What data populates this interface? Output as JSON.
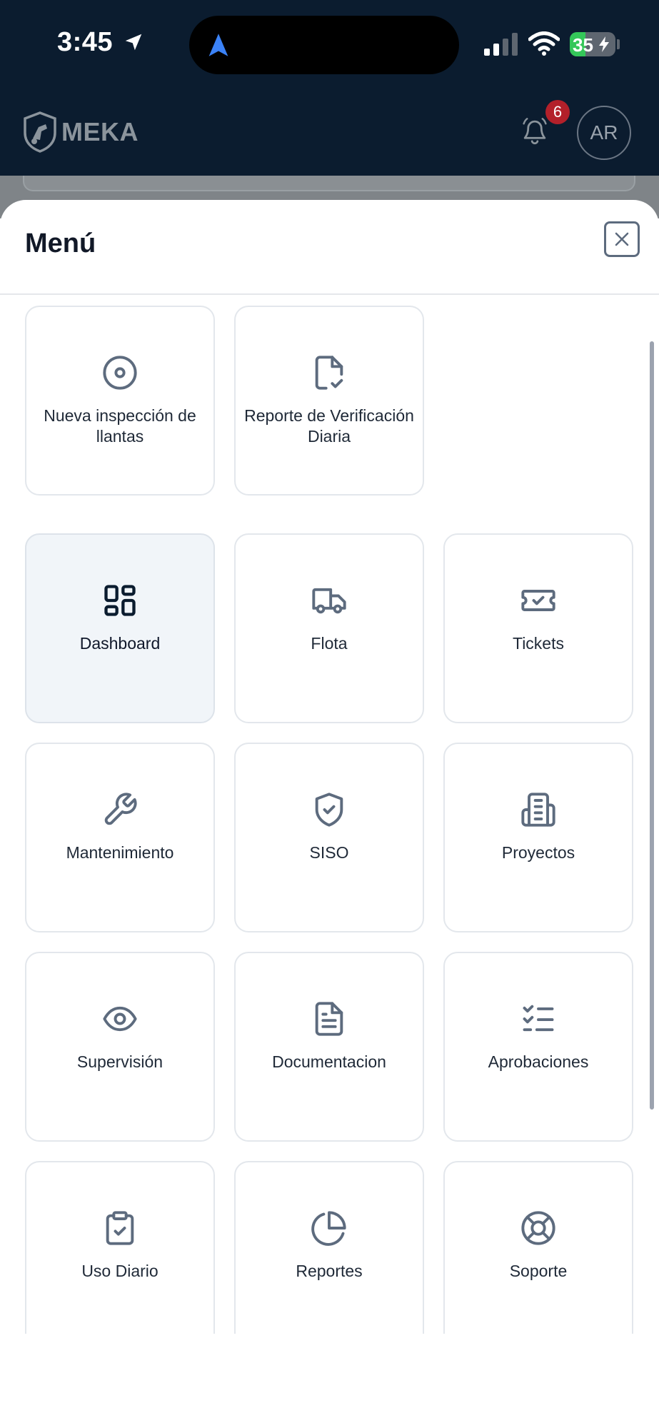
{
  "status_bar": {
    "time": "3:45",
    "battery": "35",
    "battery_level": 0.35
  },
  "header": {
    "logo_text": "MEKA",
    "notification_count": "6",
    "avatar_initials": "AR"
  },
  "menu": {
    "title": "Menú",
    "close_icon": "close-icon",
    "items": [
      {
        "label": "Nueva inspección de llantas",
        "icon": "disc-icon"
      },
      {
        "label": "Reporte de Verificación Diaria",
        "icon": "file-check-icon"
      },
      {
        "label": "Dashboard",
        "icon": "dashboard-icon",
        "active": true
      },
      {
        "label": "Flota",
        "icon": "truck-icon"
      },
      {
        "label": "Tickets",
        "icon": "ticket-icon"
      },
      {
        "label": "Mantenimiento",
        "icon": "wrench-icon"
      },
      {
        "label": "SISO",
        "icon": "shield-check-icon"
      },
      {
        "label": "Proyectos",
        "icon": "building-icon"
      },
      {
        "label": "Supervisión",
        "icon": "eye-icon"
      },
      {
        "label": "Documentacion",
        "icon": "document-icon"
      },
      {
        "label": "Aprobaciones",
        "icon": "checklist-icon"
      },
      {
        "label": "Uso Diario",
        "icon": "clipboard-check-icon"
      },
      {
        "label": "Reportes",
        "icon": "pie-chart-icon"
      },
      {
        "label": "Soporte",
        "icon": "lifebuoy-icon"
      }
    ]
  },
  "colors": {
    "header_bg": "#0b1c2f",
    "icon_stroke": "#5d6b7e",
    "active_icon": "#0b1c2f",
    "active_tile_bg": "#f1f5f9",
    "badge": "#b3202a"
  }
}
